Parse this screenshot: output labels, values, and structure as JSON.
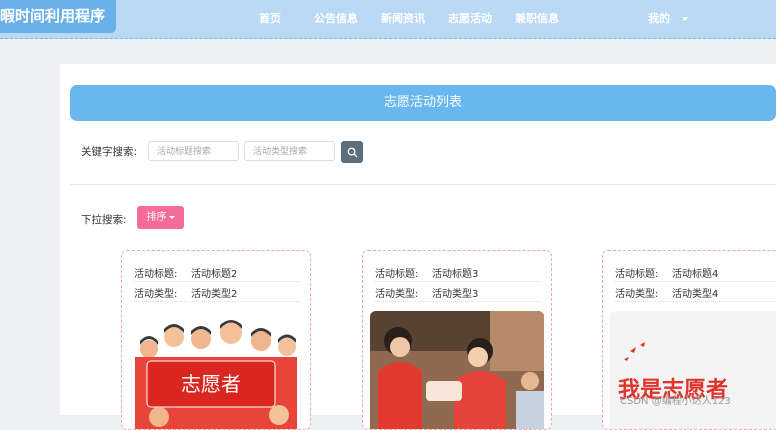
{
  "header": {
    "brand": "暇时间利用程序",
    "nav": [
      "首页",
      "公告信息",
      "新闻资讯",
      "志愿活动",
      "兼职信息"
    ],
    "user_menu": "我的"
  },
  "page": {
    "banner_title": "志愿活动列表",
    "keyword_search_label": "关键字搜索:",
    "title_placeholder": "活动标题搜索",
    "type_placeholder": "活动类型搜索",
    "dropdown_search_label": "下拉搜索:",
    "sort_label": "排序"
  },
  "cards": [
    {
      "title_key": "活动标题:",
      "title": "活动标题2",
      "type_key": "活动类型:",
      "type": "活动类型2",
      "image_text": "志愿者"
    },
    {
      "title_key": "活动标题:",
      "title": "活动标题3",
      "type_key": "活动类型:",
      "type": "活动类型3"
    },
    {
      "title_key": "活动标题:",
      "title": "活动标题4",
      "type_key": "活动类型:",
      "type": "活动类型4",
      "image_text": "我是志愿者"
    }
  ],
  "watermark": "CSDN @编程小达人123",
  "colors": {
    "primary": "#6ab7f0",
    "sort": "#f56c9b",
    "card_border": "#f3a5a5"
  }
}
